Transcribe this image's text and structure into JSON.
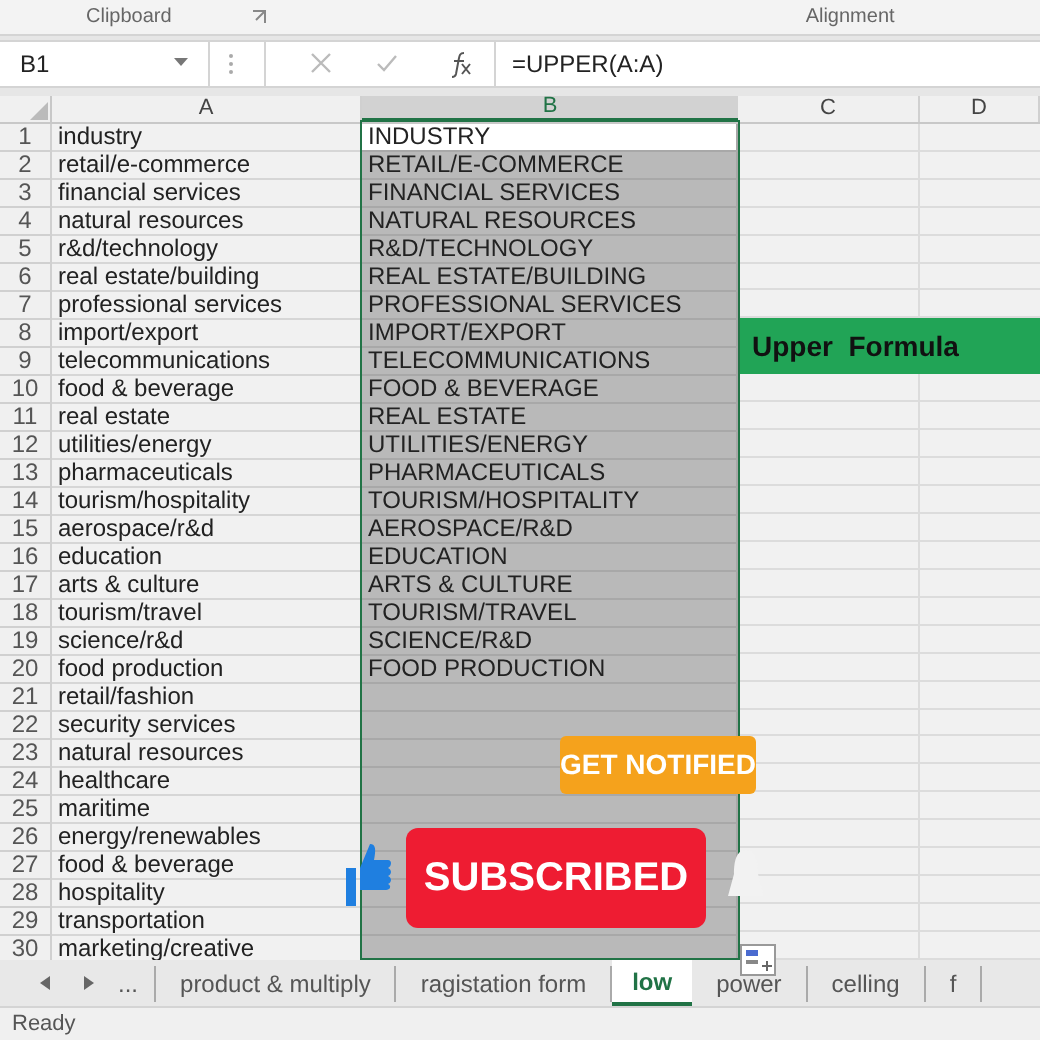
{
  "ribbon": {
    "groups": [
      "Clipboard",
      "Alignment"
    ]
  },
  "formula_bar": {
    "name_box": "B1",
    "formula": "=UPPER(A:A)"
  },
  "columns": [
    {
      "label": "A",
      "selected": false
    },
    {
      "label": "B",
      "selected": true
    },
    {
      "label": "C",
      "selected": false
    },
    {
      "label": "D",
      "selected": false
    }
  ],
  "rows": [
    {
      "row": "1",
      "a": "industry",
      "b": "INDUSTRY",
      "active": true
    },
    {
      "row": "2",
      "a": "retail/e-commerce",
      "b": "RETAIL/E-COMMERCE",
      "active": false
    },
    {
      "row": "3",
      "a": "financial services",
      "b": "FINANCIAL SERVICES",
      "active": false
    },
    {
      "row": "4",
      "a": "natural resources",
      "b": "NATURAL RESOURCES",
      "active": false
    },
    {
      "row": "5",
      "a": "r&d/technology",
      "b": "R&D/TECHNOLOGY",
      "active": false
    },
    {
      "row": "6",
      "a": "real estate/building",
      "b": "REAL ESTATE/BUILDING",
      "active": false
    },
    {
      "row": "7",
      "a": "professional services",
      "b": "PROFESSIONAL SERVICES",
      "active": false
    },
    {
      "row": "8",
      "a": "import/export",
      "b": "IMPORT/EXPORT",
      "active": false,
      "c_merged": "Upper  Formula"
    },
    {
      "row": "9",
      "a": "telecommunications",
      "b": "TELECOMMUNICATIONS",
      "active": false
    },
    {
      "row": "10",
      "a": "food & beverage",
      "b": "FOOD & BEVERAGE",
      "active": false
    },
    {
      "row": "11",
      "a": "real estate",
      "b": "REAL ESTATE",
      "active": false
    },
    {
      "row": "12",
      "a": "utilities/energy",
      "b": "UTILITIES/ENERGY",
      "active": false
    },
    {
      "row": "13",
      "a": "pharmaceuticals",
      "b": "PHARMACEUTICALS",
      "active": false
    },
    {
      "row": "14",
      "a": "tourism/hospitality",
      "b": "TOURISM/HOSPITALITY",
      "active": false
    },
    {
      "row": "15",
      "a": "aerospace/r&d",
      "b": "AEROSPACE/R&D",
      "active": false
    },
    {
      "row": "16",
      "a": "education",
      "b": "EDUCATION",
      "active": false
    },
    {
      "row": "17",
      "a": "arts & culture",
      "b": "ARTS & CULTURE",
      "active": false
    },
    {
      "row": "18",
      "a": "tourism/travel",
      "b": "TOURISM/TRAVEL",
      "active": false
    },
    {
      "row": "19",
      "a": "science/r&d",
      "b": "SCIENCE/R&D",
      "active": false
    },
    {
      "row": "20",
      "a": "food production",
      "b": "FOOD PRODUCTION",
      "active": false
    },
    {
      "row": "21",
      "a": "retail/fashion",
      "active": false
    },
    {
      "row": "22",
      "a": "security services",
      "active": false
    },
    {
      "row": "23",
      "a": "natural resources",
      "active": false
    },
    {
      "row": "24",
      "a": "healthcare",
      "active": false
    },
    {
      "row": "25",
      "a": "maritime",
      "active": false
    },
    {
      "row": "26",
      "a": "energy/renewables",
      "active": false
    },
    {
      "row": "27",
      "a": "food & beverage",
      "active": false
    },
    {
      "row": "28",
      "a": "hospitality",
      "active": false
    },
    {
      "row": "29",
      "a": "transportation",
      "active": false
    },
    {
      "row": "30",
      "a": "marketing/creative",
      "active": false
    }
  ],
  "overlays": {
    "notify": "GET NOTIFIED",
    "subscribed": "SUBSCRIBED"
  },
  "sheet_tabs": {
    "more": "...",
    "tabs": [
      {
        "label": "product & multiply",
        "selected": false
      },
      {
        "label": "ragistation form",
        "selected": false
      },
      {
        "label": "low",
        "selected": true
      },
      {
        "label": "power",
        "selected": false
      },
      {
        "label": "celling",
        "selected": false
      },
      {
        "label": "f",
        "selected": false
      }
    ]
  },
  "status_bar": {
    "text": "Ready"
  }
}
